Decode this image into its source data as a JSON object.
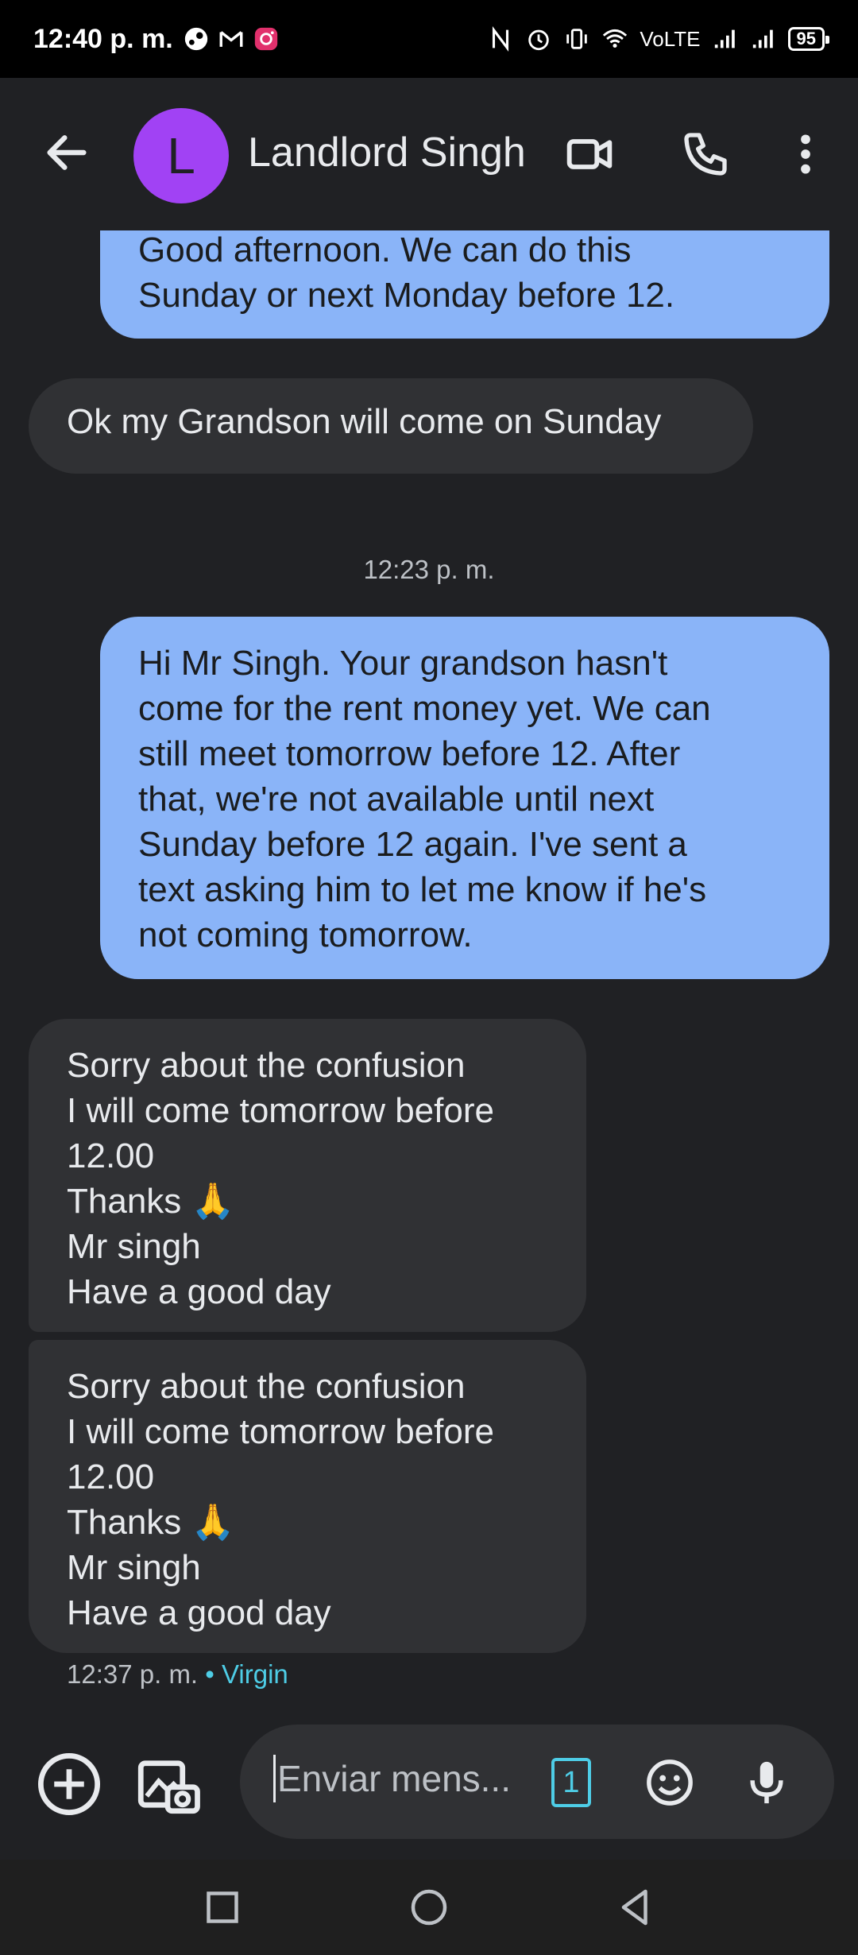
{
  "status": {
    "time": "12:40 p. m.",
    "network": "VoLTE",
    "battery": "95"
  },
  "header": {
    "avatar_letter": "L",
    "contact_name": "Landlord Singh",
    "avatar_color": "#a142f4"
  },
  "messages": [
    {
      "direction": "outgoing",
      "lines": [
        "Good afternoon. We can do this",
        "Sunday or next Monday before 12."
      ]
    },
    {
      "direction": "incoming",
      "lines": [
        "Ok my Grandson will come on Sunday"
      ]
    },
    {
      "direction": "divider",
      "time": "12:23 p. m."
    },
    {
      "direction": "outgoing",
      "lines": [
        "Hi Mr Singh. Your grandson hasn't",
        "come for the rent money yet. We can",
        "still meet tomorrow before 12. After",
        "that, we're not available until next",
        "Sunday before 12 again. I've sent a",
        "text asking him to let me know if he's",
        "not coming tomorrow."
      ]
    },
    {
      "direction": "incoming",
      "lines": [
        "Sorry about the confusion",
        "I will come tomorrow before",
        "12.00",
        "Thanks 🙏",
        "Mr singh",
        "Have a good day"
      ]
    },
    {
      "direction": "incoming",
      "lines": [
        "Sorry about the confusion",
        "I will come tomorrow before",
        "12.00",
        "Thanks 🙏",
        "Mr singh",
        "Have a good day"
      ]
    }
  ],
  "last_message_meta": {
    "time": "12:37 p. m.",
    "separator": "•",
    "carrier": "Virgin"
  },
  "composer": {
    "placeholder": "Enviar mens...",
    "sim_number": "1"
  },
  "colors": {
    "background": "#202124",
    "outgoing_bubble": "#8ab4f8",
    "incoming_bubble": "#303134",
    "carrier_accent": "#4ecde6"
  }
}
